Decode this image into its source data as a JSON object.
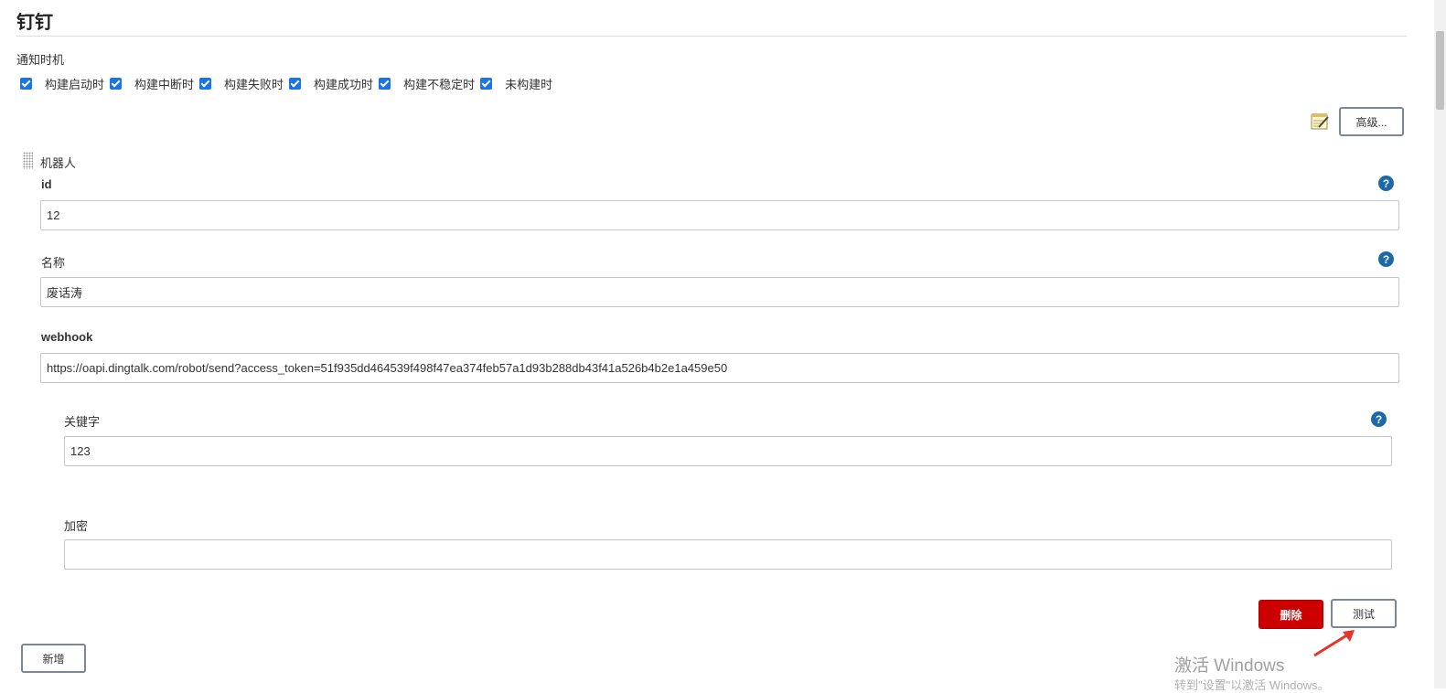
{
  "section": {
    "title": "钉钉"
  },
  "notify": {
    "label": "通知时机",
    "options": [
      {
        "label": "构建启动时",
        "checked": true
      },
      {
        "label": "构建中断时",
        "checked": true
      },
      {
        "label": "构建失败时",
        "checked": true
      },
      {
        "label": "构建成功时",
        "checked": true
      },
      {
        "label": "构建不稳定时",
        "checked": true
      },
      {
        "label": "未构建时",
        "checked": true
      }
    ]
  },
  "toolbar": {
    "notepad_icon": "notepad-edit-icon",
    "advanced_label": "高级..."
  },
  "robot": {
    "label": "机器人",
    "id": {
      "label": "id",
      "value": "12"
    },
    "name": {
      "label": "名称",
      "value": "废话涛"
    },
    "webhook": {
      "label": "webhook",
      "value": "https://oapi.dingtalk.com/robot/send?access_token=51f935dd464539f498f47ea374feb57a1d93b288db43f41a526b4b2e1a459e50"
    },
    "keyword": {
      "label": "关键字",
      "value": "123"
    },
    "secret": {
      "label": "加密",
      "value": ""
    },
    "delete_label": "删除",
    "test_label": "测试"
  },
  "add_label": "新增",
  "help_icon_glyph": "?",
  "colors": {
    "accent": "#1a73e8",
    "danger": "#cc0000",
    "help": "#1b6aa5",
    "annotation_arrow": "#e8332a"
  },
  "watermark": {
    "line1": "激活 Windows",
    "line2": "转到\"设置\"以激活 Windows。"
  }
}
